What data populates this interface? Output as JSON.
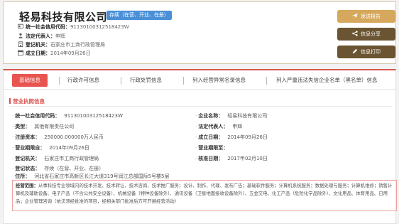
{
  "company": {
    "name": "轻易科技有限公司",
    "status": "存续（在营、开业、在册）",
    "credit_code_label": "统一社会信用代码：",
    "credit_code": "91130100312518423W",
    "legal_rep_label": "法定代表人：",
    "legal_rep": "申辉",
    "authority_label": "登记机关：",
    "authority": "石家庄市工商行政管理局",
    "est_date_label": "成立日期：",
    "est_date": "2014年09月26日"
  },
  "actions": {
    "send_report": "发送报告",
    "share": "信息分享",
    "print": "信息打印"
  },
  "tabs": [
    "基础信息",
    "行政许可信息",
    "行政处罚信息",
    "列入经营异常名录信息",
    "列入严重违法失信企业名单（黑名单）信息"
  ],
  "section_title": "营业执照信息",
  "fields": {
    "credit_code": {
      "k": "统一社会信用代码：",
      "v": "91130100312518423W"
    },
    "company_name": {
      "k": "企业名称：",
      "v": "轻易科技有限公司"
    },
    "type": {
      "k": "类型：",
      "v": "其他有限责任公司"
    },
    "legal_rep": {
      "k": "法定代表人：",
      "v": "申辉"
    },
    "capital": {
      "k": "注册资本：",
      "v": "250000.000000万人民币"
    },
    "est_date": {
      "k": "成立日期：",
      "v": "2014年09月26日"
    },
    "term_from": {
      "k": "营业期限自：",
      "v": "2014年09月26日"
    },
    "term_to": {
      "k": "营业期限至：",
      "v": ""
    },
    "authority": {
      "k": "登记机关：",
      "v": "石家庄市工商行政管理局"
    },
    "approval_date": {
      "k": "核准日期：",
      "v": "2017年02月10日"
    },
    "status": {
      "k": "登记状态：",
      "v": "存续（在营、开业、在册）"
    },
    "address": {
      "k": "住所：",
      "v": "河北省石家庄市高新区长江大道319号润江总部国际5号楼5层"
    }
  },
  "scope": {
    "k": "经营范围：",
    "v": "从事科技专业领域内的技术开发、技术转让、技术咨询、技术推广服务；设计、制作、代理、发布广告；基础软件服务；计算机系统服务；数据处理与服务；计算机维修；销售计算机及辅助设备、电子产品（不含公共安全设备）、机械设备（特种设备除外）、通讯设备（卫星地面接收设备除外）、五金交电、化工产品（危险化学品除外）、文化用品、体育用品、日用品；企业管理咨询（依法须经批准的项目，经相关部门批准后方可开展经营活动）"
  },
  "colors": {
    "accent": "#d9534f",
    "gold": "#d6a85d",
    "brown": "#6b5432",
    "status_blue": "#4a8fd7"
  }
}
